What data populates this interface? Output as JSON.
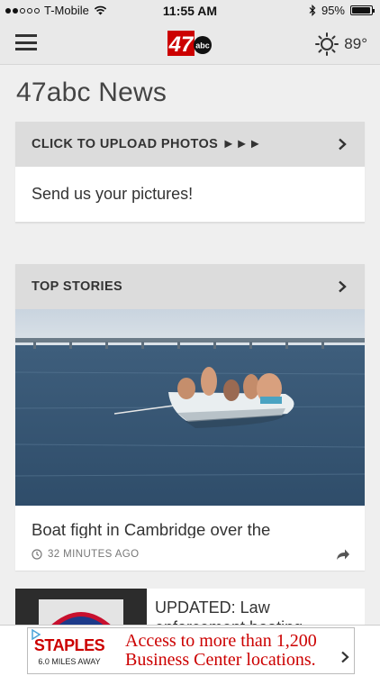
{
  "status_bar": {
    "carrier": "T-Mobile",
    "time": "11:55 AM",
    "battery": "95%",
    "battery_level": 0.95
  },
  "nav": {
    "logo_number": "47",
    "logo_text": "abc",
    "temperature": "89°"
  },
  "page": {
    "title": "47abc News"
  },
  "upload_card": {
    "header": "CLICK TO UPLOAD PHOTOS ►►►",
    "body": "Send us your pictures!"
  },
  "top_stories": {
    "header": "TOP STORIES",
    "lead": {
      "headline": "Boat fight in Cambridge over the",
      "time": "32 MINUTES AGO"
    },
    "second": {
      "headline": "UPDATED: Law enforcement boating"
    }
  },
  "ad": {
    "brand": "STAPLES",
    "distance": "6.0 MILES AWAY",
    "line1": "Access to more than 1,200",
    "line2": "Business Center locations."
  },
  "colors": {
    "brand_red": "#cc0000",
    "header_gray": "#dcdcdc"
  }
}
